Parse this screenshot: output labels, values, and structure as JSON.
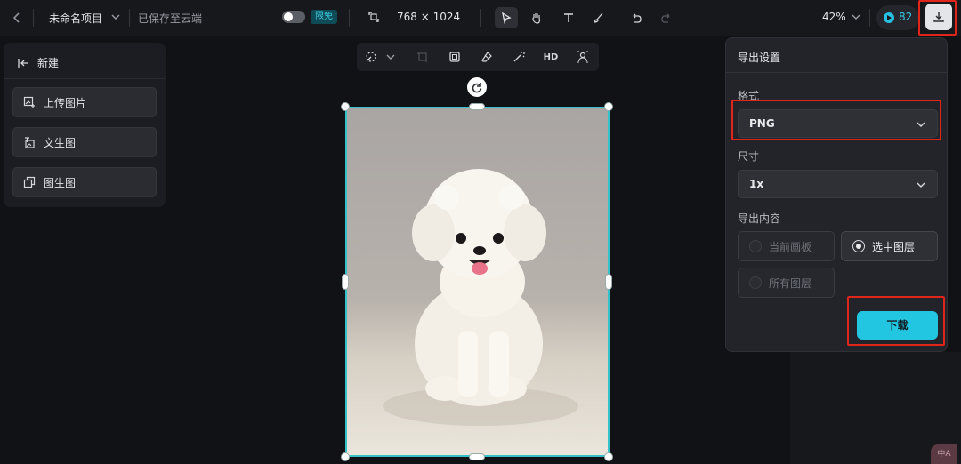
{
  "colors": {
    "accent": "#22c6e0",
    "highlight": "#e1251b",
    "selection": "#35c1c9",
    "background": "#111216"
  },
  "topbar": {
    "back_icon": "chevron-left-icon",
    "project_name": "未命名项目",
    "save_status": "已保存至云端",
    "free_badge": "限免",
    "canvas_size": "768 × 1024",
    "zoom": "42%",
    "credits": "82",
    "tools": [
      "cursor-icon",
      "hand-icon",
      "text-icon",
      "brush-icon",
      "undo-icon",
      "redo-icon"
    ],
    "download_icon": "download-icon"
  },
  "left_panel": {
    "title": "新建",
    "items": [
      {
        "label": "上传图片",
        "icon": "upload-image-icon"
      },
      {
        "label": "文生图",
        "icon": "text-to-image-icon"
      },
      {
        "label": "图生图",
        "icon": "image-to-image-icon"
      }
    ]
  },
  "float_toolbar": {
    "hd_label": "HD",
    "tools": [
      "smart-select-icon",
      "crop-icon",
      "frame-icon",
      "eraser-icon",
      "magic-wand-icon",
      "hd-icon",
      "cutout-icon"
    ]
  },
  "export_panel": {
    "title": "导出设置",
    "format_label": "格式",
    "format_value": "PNG",
    "size_label": "尺寸",
    "size_value": "1x",
    "content_label": "导出内容",
    "content_options": [
      {
        "label": "当前画板",
        "selected": false,
        "enabled": false
      },
      {
        "label": "选中图层",
        "selected": true,
        "enabled": true
      },
      {
        "label": "所有图层",
        "selected": false,
        "enabled": false
      }
    ],
    "download_label": "下载"
  },
  "corner_badge": "中A"
}
